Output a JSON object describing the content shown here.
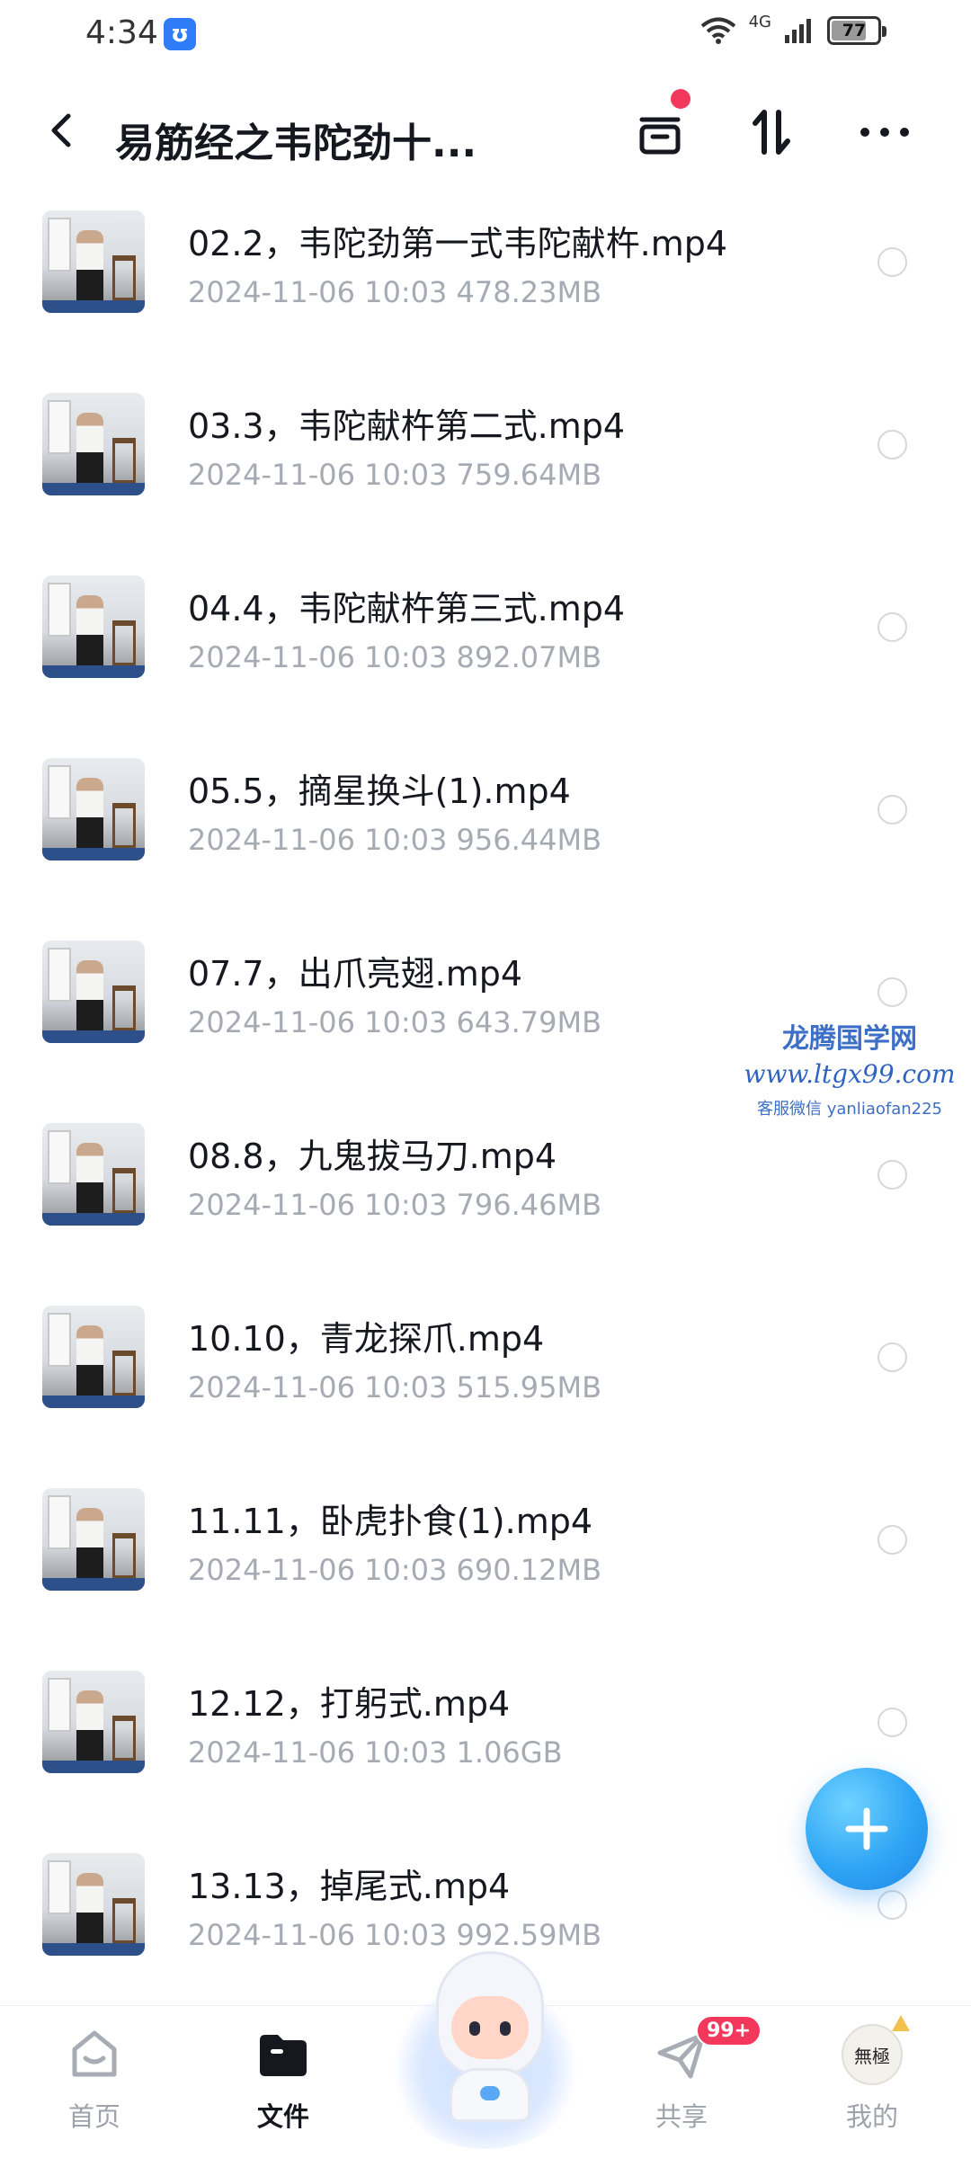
{
  "status_bar": {
    "time": "4:34",
    "app_icon_glyph": "ʊ",
    "network": "4G",
    "battery": "77",
    "battery_fraction": 0.77
  },
  "header": {
    "title": "易筋经之韦陀劲十...",
    "transfer_has_badge": true
  },
  "files": [
    {
      "name": "02.2，韦陀劲第一式韦陀献杵.mp4",
      "date": "2024-11-06  10:03",
      "size": "478.23MB"
    },
    {
      "name": "03.3，韦陀献杵第二式.mp4",
      "date": "2024-11-06  10:03",
      "size": "759.64MB"
    },
    {
      "name": "04.4，韦陀献杵第三式.mp4",
      "date": "2024-11-06  10:03",
      "size": "892.07MB"
    },
    {
      "name": "05.5，摘星换斗(1).mp4",
      "date": "2024-11-06  10:03",
      "size": "956.44MB"
    },
    {
      "name": "07.7，出爪亮翅.mp4",
      "date": "2024-11-06  10:03",
      "size": "643.79MB"
    },
    {
      "name": "08.8，九鬼拔马刀.mp4",
      "date": "2024-11-06  10:03",
      "size": "796.46MB"
    },
    {
      "name": "10.10，青龙探爪.mp4",
      "date": "2024-11-06  10:03",
      "size": "515.95MB"
    },
    {
      "name": "11.11，卧虎扑食(1).mp4",
      "date": "2024-11-06  10:03",
      "size": "690.12MB"
    },
    {
      "name": "12.12，打躬式.mp4",
      "date": "2024-11-06  10:03",
      "size": "1.06GB"
    },
    {
      "name": "13.13，掉尾式.mp4",
      "date": "2024-11-06  10:03",
      "size": "992.59MB"
    }
  ],
  "watermark": {
    "title": "龙腾国学网",
    "url": "www.ltgx99.com",
    "contact": "客服微信 yanliaofan225"
  },
  "bottom_nav": {
    "home": "首页",
    "files": "文件",
    "share": "共享",
    "share_badge": "99+",
    "mine": "我的",
    "avatar_text": "無極"
  },
  "colors": {
    "accent_blue": "#2fa5f5",
    "badge_red": "#f4385c",
    "meta_gray": "#a6abb3"
  }
}
